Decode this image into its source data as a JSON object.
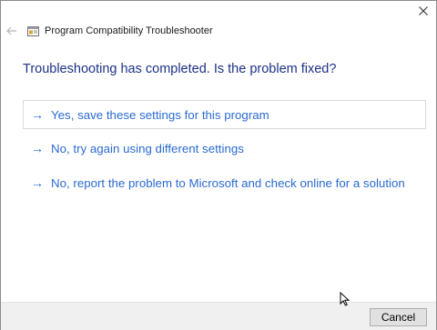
{
  "window": {
    "title": "Program Compatibility Troubleshooter",
    "back_icon": "back-arrow-icon",
    "close_icon": "close-icon",
    "app_icon": "compatibility-troubleshooter-icon"
  },
  "main": {
    "heading": "Troubleshooting has completed.  Is the problem fixed?",
    "options": [
      {
        "label": "Yes, save these settings for this program",
        "focused": true
      },
      {
        "label": "No, try again using different settings",
        "focused": false
      },
      {
        "label": "No, report the problem to Microsoft and check online for a solution",
        "focused": false
      }
    ],
    "option_icon": "right-arrow-icon"
  },
  "footer": {
    "cancel_label": "Cancel"
  },
  "colors": {
    "heading": "#1e3287",
    "link": "#2a6bd1",
    "footer_bg": "#f0f0f0"
  }
}
